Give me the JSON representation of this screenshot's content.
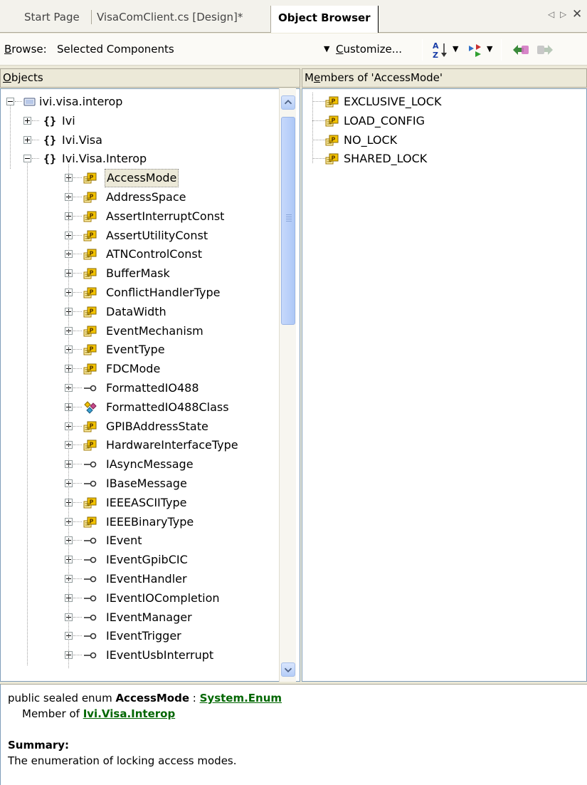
{
  "tabs": [
    {
      "label": "Start Page"
    },
    {
      "label": "VisaComClient.cs [Design]*"
    },
    {
      "label": "Object Browser"
    }
  ],
  "tab_nav": {
    "prev": "◁",
    "next": "▷",
    "close": "✕"
  },
  "toolbar": {
    "browse_label": "Browse:",
    "browse_value": "Selected Components",
    "customize_label": "Customize..."
  },
  "objects_pane": {
    "header": "Objects",
    "root": "ivi.visa.interop",
    "namespaces": [
      "Ivi",
      "Ivi.Visa",
      "Ivi.Visa.Interop"
    ],
    "selected": "AccessMode",
    "items": [
      {
        "label": "AccessMode",
        "kind": "enum"
      },
      {
        "label": "AddressSpace",
        "kind": "enum"
      },
      {
        "label": "AssertInterruptConst",
        "kind": "enum"
      },
      {
        "label": "AssertUtilityConst",
        "kind": "enum"
      },
      {
        "label": "ATNControlConst",
        "kind": "enum"
      },
      {
        "label": "BufferMask",
        "kind": "enum"
      },
      {
        "label": "ConflictHandlerType",
        "kind": "enum"
      },
      {
        "label": "DataWidth",
        "kind": "enum"
      },
      {
        "label": "EventMechanism",
        "kind": "enum"
      },
      {
        "label": "EventType",
        "kind": "enum"
      },
      {
        "label": "FDCMode",
        "kind": "enum"
      },
      {
        "label": "FormattedIO488",
        "kind": "interface"
      },
      {
        "label": "FormattedIO488Class",
        "kind": "class"
      },
      {
        "label": "GPIBAddressState",
        "kind": "enum"
      },
      {
        "label": "HardwareInterfaceType",
        "kind": "enum"
      },
      {
        "label": "IAsyncMessage",
        "kind": "interface"
      },
      {
        "label": "IBaseMessage",
        "kind": "interface"
      },
      {
        "label": "IEEEASCIIType",
        "kind": "enum"
      },
      {
        "label": "IEEEBinaryType",
        "kind": "enum"
      },
      {
        "label": "IEvent",
        "kind": "interface"
      },
      {
        "label": "IEventGpibCIC",
        "kind": "interface"
      },
      {
        "label": "IEventHandler",
        "kind": "interface"
      },
      {
        "label": "IEventIOCompletion",
        "kind": "interface"
      },
      {
        "label": "IEventManager",
        "kind": "interface"
      },
      {
        "label": "IEventTrigger",
        "kind": "interface"
      },
      {
        "label": "IEventUsbInterrupt",
        "kind": "interface"
      }
    ]
  },
  "members_pane": {
    "header": "Members of 'AccessMode'",
    "items": [
      "EXCLUSIVE_LOCK",
      "LOAD_CONFIG",
      "NO_LOCK",
      "SHARED_LOCK"
    ]
  },
  "description": {
    "prefix": "public sealed enum ",
    "name": "AccessMode",
    "sep": " : ",
    "base_link": "System.Enum",
    "member_of_label": "Member of ",
    "member_of_link": "Ivi.Visa.Interop",
    "summary_label": "Summary:",
    "summary_text": "The enumeration of locking access modes."
  },
  "colors": {
    "enum_icon": "#e8b800",
    "link": "#006600",
    "scrollbar": "#b8cff9"
  }
}
